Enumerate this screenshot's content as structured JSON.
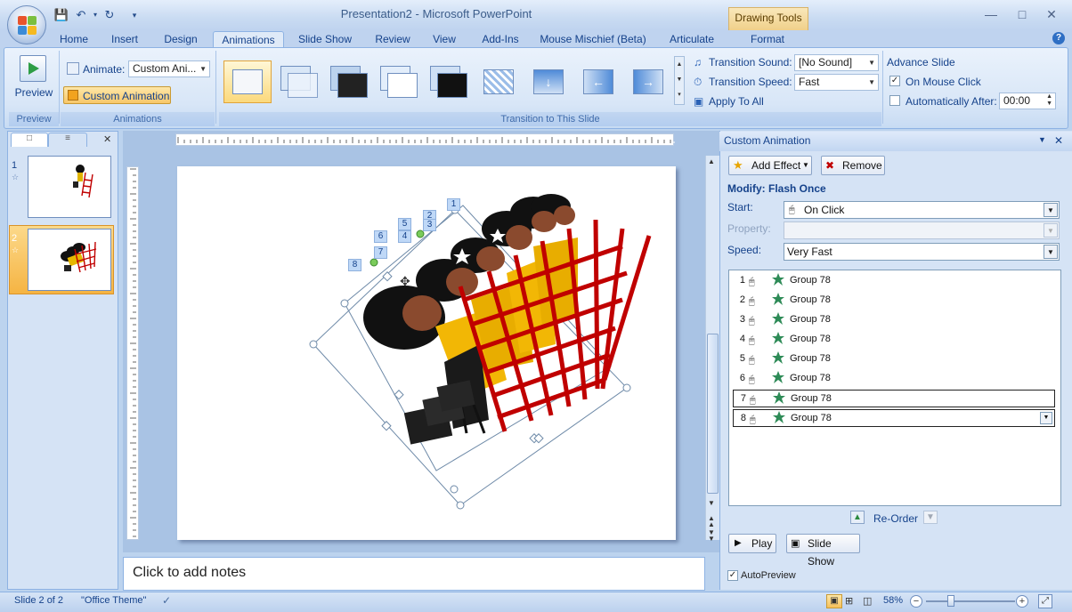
{
  "window": {
    "title": "Presentation2 - Microsoft PowerPoint",
    "contextual_tab": "Drawing Tools"
  },
  "tabs": [
    "Home",
    "Insert",
    "Design",
    "Animations",
    "Slide Show",
    "Review",
    "View",
    "Add-Ins",
    "Mouse Mischief (Beta)",
    "Articulate",
    "Format"
  ],
  "ribbon": {
    "preview": {
      "label": "Preview",
      "group": "Preview"
    },
    "animations": {
      "animate_label": "Animate:",
      "animate_value": "Custom Ani...",
      "custom_button": "Custom Animation",
      "group": "Animations"
    },
    "transition": {
      "sound_label": "Transition Sound:",
      "sound_value": "[No Sound]",
      "speed_label": "Transition Speed:",
      "speed_value": "Fast",
      "apply_all": "Apply To All",
      "group": "Transition to This Slide"
    },
    "advance": {
      "title": "Advance Slide",
      "mouse_click": "On Mouse Click",
      "mouse_click_checked": true,
      "auto_label": "Automatically After:",
      "auto_value": "00:00",
      "auto_checked": false
    }
  },
  "slides_pane": {
    "slides": [
      {
        "num": "1"
      },
      {
        "num": "2"
      }
    ],
    "selected": 2
  },
  "notes_placeholder": "Click to add notes",
  "custom_animation": {
    "title": "Custom Animation",
    "add_effect": "Add Effect",
    "remove": "Remove",
    "modify": "Modify: Flash Once",
    "start_label": "Start:",
    "start_value": "On Click",
    "property_label": "Property:",
    "property_value": "",
    "speed_label": "Speed:",
    "speed_value": "Very Fast",
    "items": [
      {
        "num": "1",
        "name": "Group 78"
      },
      {
        "num": "2",
        "name": "Group 78"
      },
      {
        "num": "3",
        "name": "Group 78"
      },
      {
        "num": "4",
        "name": "Group 78"
      },
      {
        "num": "5",
        "name": "Group 78"
      },
      {
        "num": "6",
        "name": "Group 78"
      },
      {
        "num": "7",
        "name": "Group 78"
      },
      {
        "num": "8",
        "name": "Group 78"
      }
    ],
    "reorder": "Re-Order",
    "play": "Play",
    "slide_show": "Slide Show",
    "autopreview": "AutoPreview",
    "autopreview_checked": true
  },
  "slide_badges": [
    "1",
    "2",
    "3",
    "4",
    "5",
    "6",
    "7",
    "8"
  ],
  "status": {
    "slide": "Slide 2 of 2",
    "theme": "\"Office Theme\"",
    "zoom": "58%"
  },
  "colors": {
    "accent_orange": "#f7c45f",
    "ribbon_blue": "#15428b",
    "ladder_red": "#c00000"
  }
}
